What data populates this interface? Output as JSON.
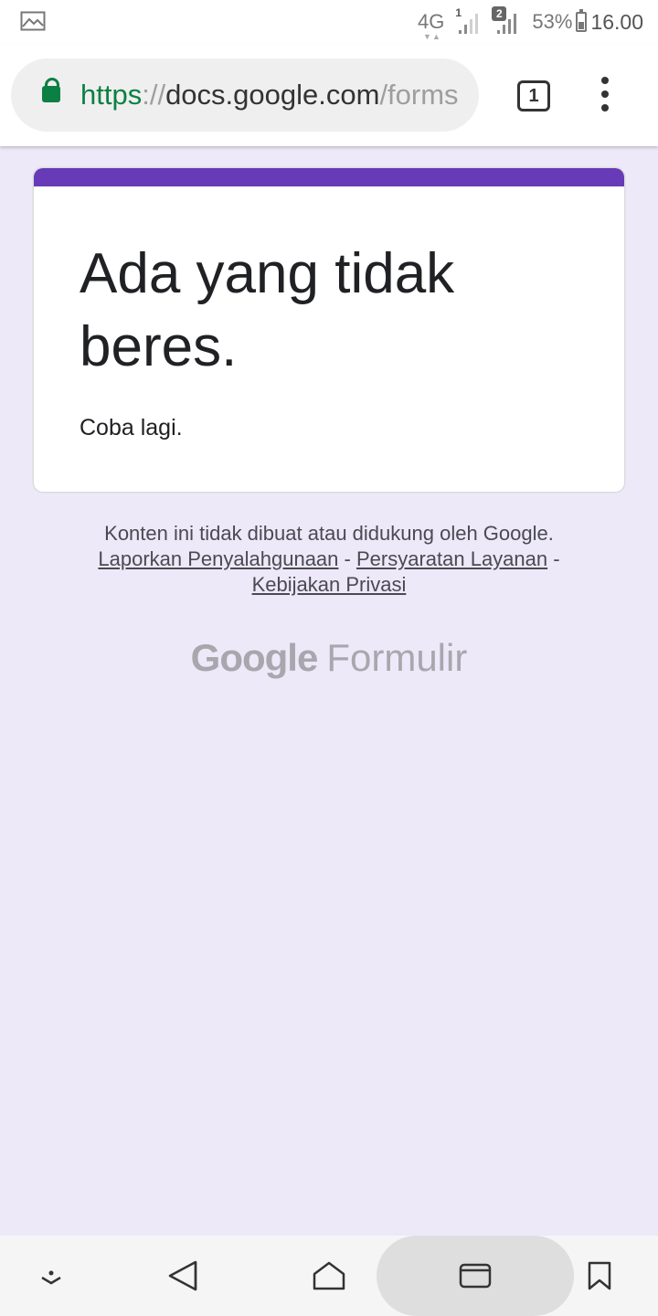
{
  "status_bar": {
    "network": "4G",
    "sim1": "1",
    "sim2": "2",
    "battery_percent": "53%",
    "battery_level": 0.53,
    "time": "16.00"
  },
  "browser": {
    "url_scheme": "https",
    "url_sep": "://",
    "url_host": "docs.google.com",
    "url_path": "/forms",
    "tab_count": "1",
    "secure_color": "#0b8043"
  },
  "card": {
    "accent_color": "#673ab7",
    "title": "Ada yang tidak beres.",
    "subtitle": "Coba lagi."
  },
  "footer": {
    "disclaimer": "Konten ini tidak dibuat atau didukung oleh Google.",
    "link_report": "Laporkan Penyalahgunaan",
    "link_terms": "Persyaratan Layanan",
    "link_privacy": "Kebijakan Privasi",
    "separator": " - "
  },
  "brand": {
    "google": "Google",
    "product": "Formulir"
  },
  "nav": {
    "icons": [
      "hide-keyboard-icon",
      "back-icon",
      "home-icon",
      "recents-icon",
      "bookmark-icon"
    ]
  }
}
